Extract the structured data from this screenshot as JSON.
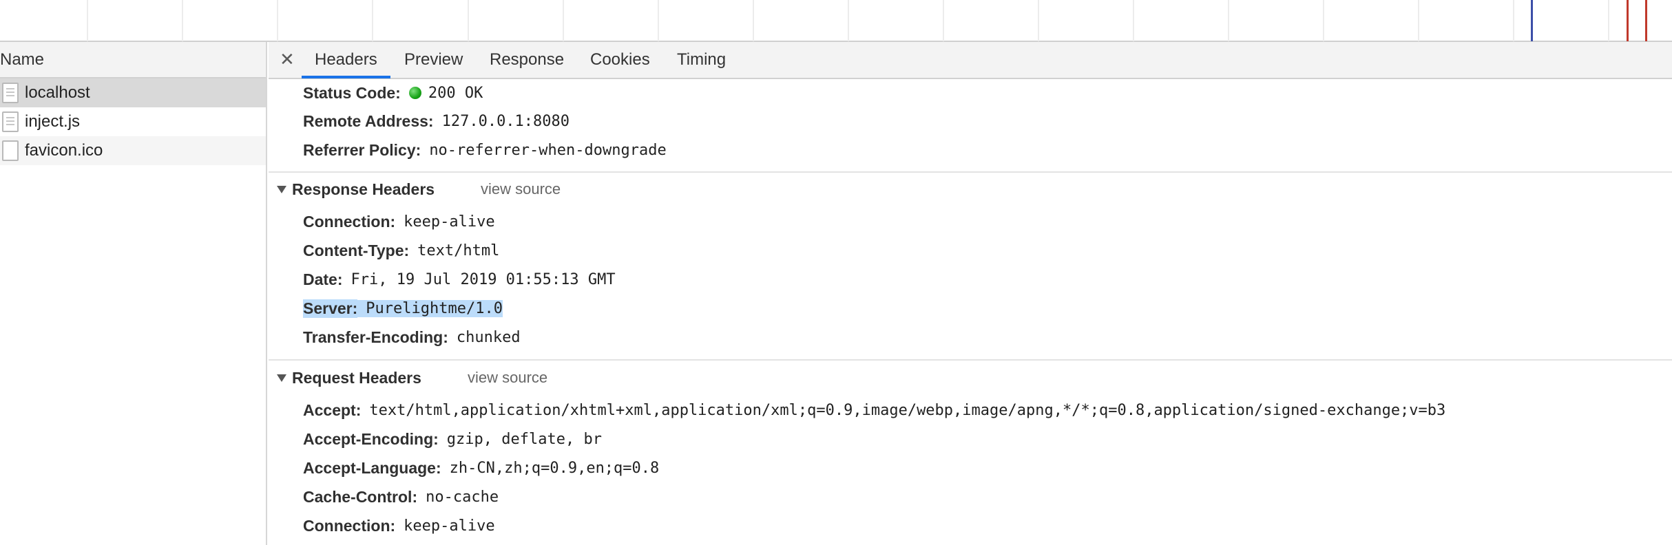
{
  "colors": {
    "accent": "#1a73e8",
    "status_ok": "#17a317",
    "selection": "#bcdcfa",
    "timeline_marker_blue": "#3c4fa8",
    "timeline_marker_red": "#c0392b"
  },
  "request_list": {
    "header": "Name",
    "items": [
      {
        "name": "localhost",
        "icon": "document-icon",
        "selected": true
      },
      {
        "name": "inject.js",
        "icon": "script-file-icon",
        "selected": false
      },
      {
        "name": "favicon.ico",
        "icon": "blank-file-icon",
        "selected": false
      }
    ]
  },
  "tabs": {
    "close_icon": "close-icon",
    "items": [
      "Headers",
      "Preview",
      "Response",
      "Cookies",
      "Timing"
    ],
    "active": "Headers"
  },
  "general": {
    "status_code_key": "Status Code:",
    "status_code_value": "200 OK",
    "remote_address_key": "Remote Address:",
    "remote_address_value": "127.0.0.1:8080",
    "referrer_policy_key": "Referrer Policy:",
    "referrer_policy_value": "no-referrer-when-downgrade"
  },
  "response_headers": {
    "title": "Response Headers",
    "view_source": "view source",
    "rows": [
      {
        "key": "Connection:",
        "value": "keep-alive"
      },
      {
        "key": "Content-Type:",
        "value": "text/html"
      },
      {
        "key": "Date:",
        "value": "Fri, 19 Jul 2019 01:55:13 GMT"
      },
      {
        "key": "Server:",
        "value": "Purelightme/1.0"
      },
      {
        "key": "Transfer-Encoding:",
        "value": "chunked"
      }
    ]
  },
  "request_headers": {
    "title": "Request Headers",
    "view_source": "view source",
    "rows": [
      {
        "key": "Accept:",
        "value": "text/html,application/xhtml+xml,application/xml;q=0.9,image/webp,image/apng,*/*;q=0.8,application/signed-exchange;v=b3"
      },
      {
        "key": "Accept-Encoding:",
        "value": "gzip, deflate, br"
      },
      {
        "key": "Accept-Language:",
        "value": "zh-CN,zh;q=0.9,en;q=0.8"
      },
      {
        "key": "Cache-Control:",
        "value": "no-cache"
      },
      {
        "key": "Connection:",
        "value": "keep-alive"
      }
    ]
  }
}
